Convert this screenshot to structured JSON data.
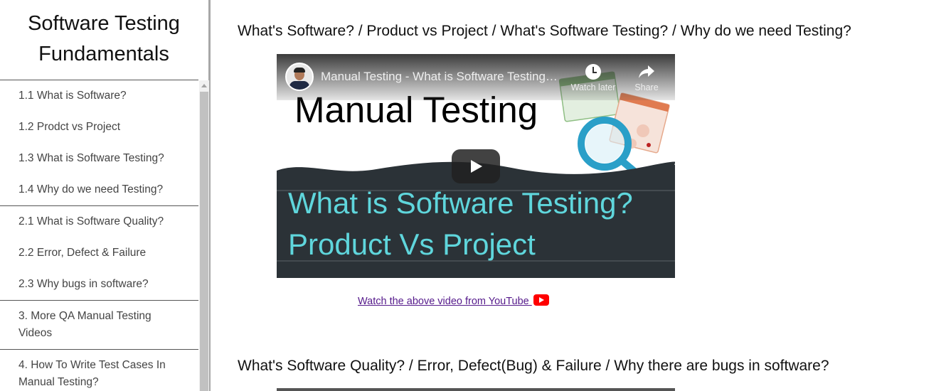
{
  "sidebar": {
    "title_line1": "Software Testing",
    "title_line2": "Fundamentals",
    "items": [
      {
        "label": "1.1 What is Software?"
      },
      {
        "label": "1.2 Prodct vs Project"
      },
      {
        "label": "1.3 What is Software Testing?"
      },
      {
        "label": "1.4 Why do we need Testing?"
      },
      {
        "label": "2.1 What is Software Quality?"
      },
      {
        "label": "2.2 Error, Defect & Failure"
      },
      {
        "label": "2.3 Why bugs in software?"
      },
      {
        "label": "3. More QA Manual Testing Videos"
      },
      {
        "label": "4. How To Write Test Cases In Manual Testing?"
      }
    ]
  },
  "main": {
    "section1_heading": "What's Software? / Product vs Project / What's Software Testing? / Why do we need Testing?",
    "section2_heading": "What's Software Quality? / Error, Defect(Bug) & Failure / Why there are bugs in software?",
    "video": {
      "title": "Manual Testing - What is Software Testing? Product Vs Project",
      "watch_later_label": "Watch later",
      "share_label": "Share",
      "thumbnail_heading": "Manual Testing",
      "thumbnail_line1": "What is Software Testing?",
      "thumbnail_line2": "Product Vs Project",
      "play_icon": "play-icon"
    },
    "youtube_link_text": "Watch the above video from YouTube ",
    "youtube_icon": "youtube-icon"
  },
  "colors": {
    "thumbnail_accent": "#5fd6dc",
    "thumbnail_dark": "#2b3237",
    "link_visited": "#551a8b",
    "youtube_red": "#ff0000"
  }
}
